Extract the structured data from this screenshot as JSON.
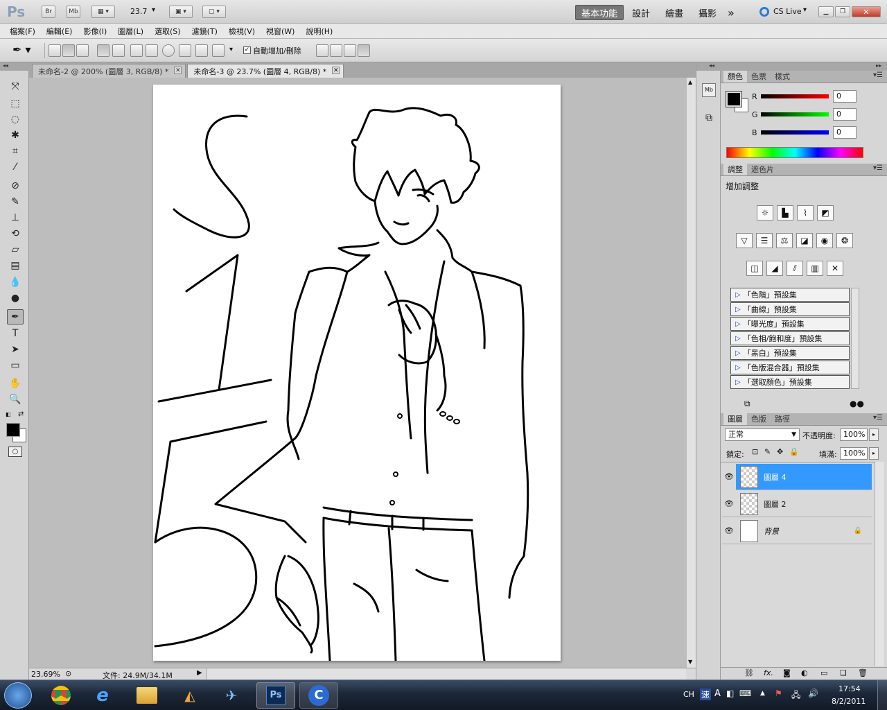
{
  "app": {
    "logo": "Ps",
    "bridge_label": "Br",
    "minibridge_label": "Mb",
    "zoom_readout": "23.7",
    "workspaces": [
      "基本功能",
      "設計",
      "繪畫",
      "攝影"
    ],
    "more_label": "»",
    "cs_live": "CS Live"
  },
  "menu": [
    "檔案(F)",
    "編輯(E)",
    "影像(I)",
    "圖層(L)",
    "選取(S)",
    "濾鏡(T)",
    "檢視(V)",
    "視窗(W)",
    "說明(H)"
  ],
  "options": {
    "auto_add_delete": "自動增加/刪除"
  },
  "tabs": [
    {
      "label": "未命名-2 @ 200% (圖層 3, RGB/8) *",
      "close": "✕"
    },
    {
      "label": "未命名-3 @ 23.7% (圖層 4, RGB/8) *",
      "close": "✕"
    }
  ],
  "status": {
    "zoom": "23.69%",
    "doc_info": "文件: 24.9M/34.1M"
  },
  "color_panel": {
    "tabs": [
      "顏色",
      "色票",
      "樣式"
    ],
    "r_label": "R",
    "g_label": "G",
    "b_label": "B",
    "r": "0",
    "g": "0",
    "b": "0",
    "foreground": "#000000",
    "background": "#ffffff"
  },
  "adjust_panel": {
    "tabs": [
      "調整",
      "遮色片"
    ],
    "title": "增加調整",
    "presets": [
      "「色階」預設集",
      "「曲線」預設集",
      "「曝光度」預設集",
      "「色相/飽和度」預設集",
      "「黑白」預設集",
      "「色版混合器」預設集",
      "「選取顏色」預設集"
    ]
  },
  "layers_panel": {
    "tabs": [
      "圖層",
      "色版",
      "路徑"
    ],
    "blend_mode": "正常",
    "opacity_label": "不透明度:",
    "opacity": "100%",
    "lock_label": "鎖定:",
    "fill_label": "填滿:",
    "fill": "100%",
    "layers": [
      {
        "name": "圖層 4",
        "selected": true
      },
      {
        "name": "圖層 2",
        "selected": false
      },
      {
        "name": "背景",
        "selected": false
      }
    ]
  },
  "taskbar": {
    "lang": "CH",
    "time": "17:54",
    "date": "8/2/2011"
  },
  "colors": {
    "selection": "#3399ff",
    "canvas": "#ffffff"
  }
}
